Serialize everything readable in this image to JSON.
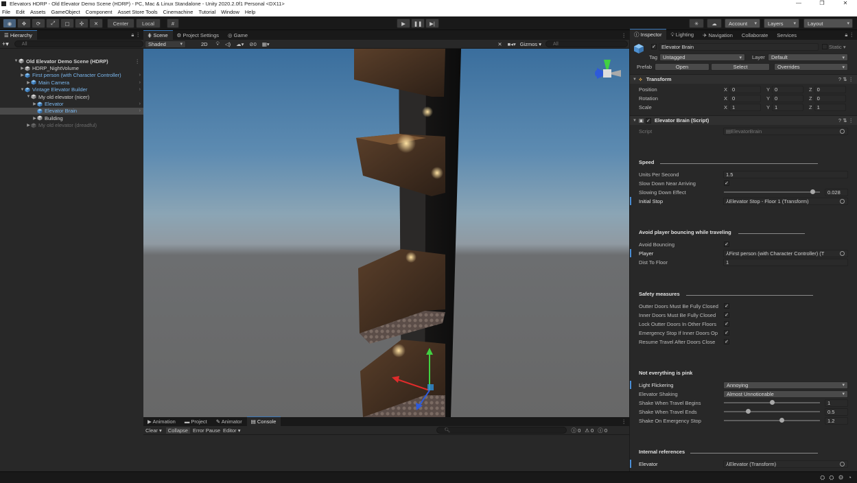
{
  "window": {
    "title": "Elevators HDRP - Old Elevator Demo Scene (HDRP) - PC, Mac & Linux Standalone - Unity 2020.2.0f1 Personal <DX11>"
  },
  "menu": [
    "File",
    "Edit",
    "Assets",
    "GameObject",
    "Component",
    "Asset Store Tools",
    "Cinemachine",
    "Tutorial",
    "Window",
    "Help"
  ],
  "toolbar": {
    "pivot_mode": "Center",
    "pivot_rotation": "Local",
    "account": "Account",
    "layers": "Layers",
    "layout": "Layout"
  },
  "hierarchy": {
    "tab": "Hierarchy",
    "search_placeholder": "All",
    "items": [
      {
        "label": "Old Elevator Demo Scene (HDRP)",
        "depth": 0,
        "type": "scene",
        "arrow": "▼"
      },
      {
        "label": "HDRP_NightVolume",
        "depth": 1,
        "type": "go",
        "arrow": "▶"
      },
      {
        "label": "First person (with Character Controller)",
        "depth": 1,
        "type": "prefab",
        "arrow": "▶"
      },
      {
        "label": "Main Camera",
        "depth": 2,
        "type": "prefab",
        "arrow": "▶"
      },
      {
        "label": "Vintage Elevator Builder",
        "depth": 1,
        "type": "prefab",
        "arrow": "▼"
      },
      {
        "label": "My old elevator (nicer)",
        "depth": 2,
        "type": "go",
        "arrow": "▼"
      },
      {
        "label": "Elevator",
        "depth": 3,
        "type": "prefab",
        "arrow": "▶"
      },
      {
        "label": "Elevator Brain",
        "depth": 3,
        "type": "prefab",
        "arrow": "",
        "selected": true
      },
      {
        "label": "Building",
        "depth": 3,
        "type": "go",
        "arrow": "▶"
      },
      {
        "label": "My old elevator (dreadful)",
        "depth": 2,
        "type": "dim",
        "arrow": "▶"
      }
    ]
  },
  "scene": {
    "tabs": [
      "Scene",
      "Project Settings",
      "Game"
    ],
    "shading": "Shaded",
    "mode_2d": "2D",
    "fx_count": "0",
    "gizmos": "Gizmos",
    "search_placeholder": "All"
  },
  "console": {
    "tabs": [
      "Animation",
      "Project",
      "Animator",
      "Console"
    ],
    "clear": "Clear",
    "collapse": "Collapse",
    "error_pause": "Error Pause",
    "editor": "Editor",
    "counts": [
      "0",
      "0",
      "0"
    ]
  },
  "inspector": {
    "tabs": [
      "Inspector",
      "Lighting",
      "Navigation",
      "Collaborate",
      "Services"
    ],
    "object_name": "Elevator Brain",
    "static": "Static",
    "tag_label": "Tag",
    "tag_value": "Untagged",
    "layer_label": "Layer",
    "layer_value": "Default",
    "prefab_label": "Prefab",
    "open": "Open",
    "select": "Select",
    "overrides": "Overrides",
    "transform": {
      "title": "Transform",
      "position_label": "Position",
      "position": [
        "0",
        "0",
        "0"
      ],
      "rotation_label": "Rotation",
      "rotation": [
        "0",
        "0",
        "0"
      ],
      "scale_label": "Scale",
      "scale": [
        "1",
        "1",
        "1"
      ]
    },
    "script": {
      "title": "Elevator Brain (Script)",
      "script_label": "Script",
      "script_value": "ElevatorBrain"
    },
    "speed_header": "Speed",
    "units_per_second_label": "Units Per Second",
    "units_per_second": "1.5",
    "slow_down_label": "Slow Down Near Arriving",
    "slowing_effect_label": "Slowing Down Effect",
    "slowing_effect_value": "0.028",
    "slowing_effect_fraction": 0.92,
    "initial_stop_label": "Initial Stop",
    "initial_stop_value": "Elevator Stop - Floor 1 (Transform)",
    "bounce_header": "Avoid player bouncing while traveling",
    "avoid_bouncing_label": "Avoid Bouncing",
    "player_label": "Player",
    "player_value": "First person (with Character Controller) (T",
    "dist_to_floor_label": "Dist To Floor",
    "dist_to_floor": "1",
    "safety_header": "Safety measures",
    "safety": [
      "Outter Doors Must Be Fully Closed",
      "Inner Doors Must Be Fully Closed",
      "Lock Outter Doors In Other Floors",
      "Emergency Stop If Inner Doors Op",
      "Resume Travel After Doors Close"
    ],
    "pink_header": "Not everything is pink",
    "light_flicker_label": "Light Flickering",
    "light_flicker_value": "Annoying",
    "shaking_label": "Elevator Shaking",
    "shaking_value": "Almost Unnoticeable",
    "shake_begin_label": "Shake When Travel Begins",
    "shake_begin": "1",
    "shake_begin_fraction": 0.5,
    "shake_end_label": "Shake When Travel Ends",
    "shake_end": "0.5",
    "shake_end_fraction": 0.25,
    "shake_emergency_label": "Shake On Emergency Stop",
    "shake_emergency": "1.2",
    "shake_emergency_fraction": 0.6,
    "internal_header": "Internal references",
    "elevator_label": "Elevator",
    "elevator_value": "Elevator (Transform)"
  },
  "colors": {
    "accent": "#3a79bb",
    "prefab_text": "#7bb8ef",
    "panel": "#282828"
  }
}
